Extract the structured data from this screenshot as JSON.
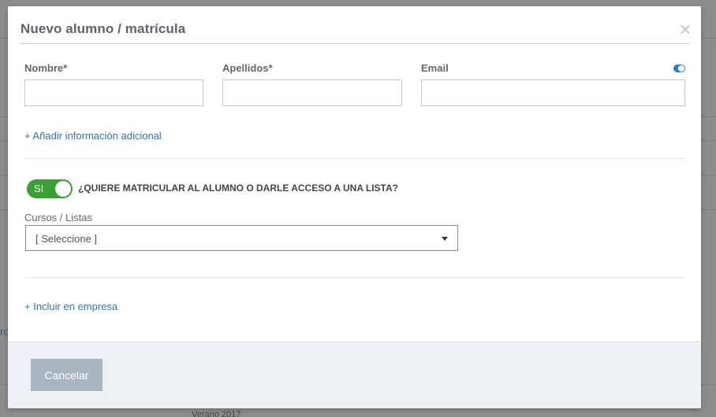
{
  "background": {
    "partial_text_left": "rc",
    "partial_text_bottom": "Verano 2017"
  },
  "modal": {
    "title": "Nuevo alumno / matrícula",
    "close_glyph": "×",
    "fields": {
      "nombre": {
        "label": "Nombre*",
        "value": ""
      },
      "apellidos": {
        "label": "Apellidos*",
        "value": ""
      },
      "email": {
        "label": "Email",
        "value": ""
      }
    },
    "email_toggle": {
      "state": "on",
      "color": "#2f7ad3"
    },
    "add_info_link": "+ Añadir información adicional",
    "enroll": {
      "switch_label": "SI",
      "switch_state": "on",
      "switch_color": "#3aa033",
      "question": "¿QUIERE MATRICULAR AL ALUMNO O DARLE ACCESO A UNA LISTA?"
    },
    "courses": {
      "label": "Cursos / Listas",
      "selected": "[ Seleccione ]"
    },
    "company_link": "+ Incluir en empresa",
    "footer": {
      "cancel_label": "Cancelar"
    }
  }
}
